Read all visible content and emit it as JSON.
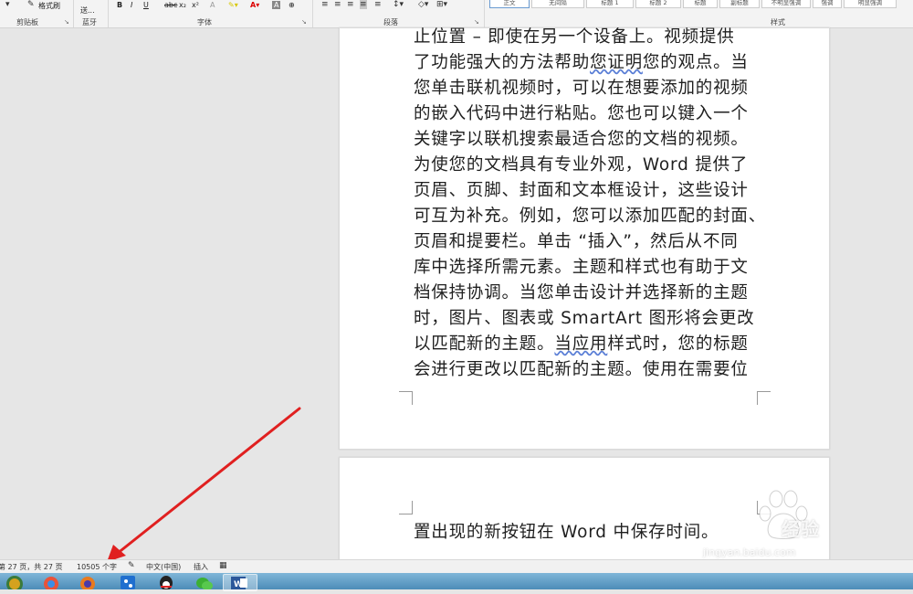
{
  "ribbon": {
    "groups": {
      "clipboard": "剪贴板",
      "bluetooth": "蓝牙",
      "font": "字体",
      "paragraph": "段落",
      "styles": "样式"
    },
    "format_painter": "格式刷",
    "send": "送...",
    "style_items": [
      "正文",
      "无间隔",
      "标题 1",
      "标题 2",
      "标题",
      "副标题",
      "不明显强调",
      "强调",
      "明显强调"
    ]
  },
  "document": {
    "page1_lines": [
      "止位置 – 即使在另一个设备上。视频提供",
      "了功能强大的方法帮助您证明您的观点。当",
      "您单击联机视频时，可以在想要添加的视频",
      "的嵌入代码中进行粘贴。您也可以键入一个",
      "关键字以联机搜索最适合您的文档的视频。",
      "为使您的文档具有专业外观，Word 提供了",
      "页眉、页脚、封面和文本框设计，这些设计",
      "可互为补充。例如，您可以添加匹配的封面、",
      "页眉和提要栏。单击 “插入”，然后从不同",
      "库中选择所需元素。主题和样式也有助于文",
      "档保持协调。当您单击设计并选择新的主题",
      "时，图片、图表或 SmartArt 图形将会更改",
      "以匹配新的主题。当应用样式时，您的标题",
      "会进行更改以匹配新的主题。使用在需要位"
    ],
    "page2_lines": [
      "置出现的新按钮在 Word 中保存时间。"
    ]
  },
  "statusbar": {
    "page": "第 27 页，共 27 页",
    "words": "10505 个字",
    "language": "中文(中国)",
    "mode": "插入"
  },
  "watermark": {
    "brand": "经验",
    "url": "jingyan.baidu.com"
  },
  "colors": {
    "annotation_arrow": "#e02020",
    "taskbar": "#5b9cc7"
  }
}
